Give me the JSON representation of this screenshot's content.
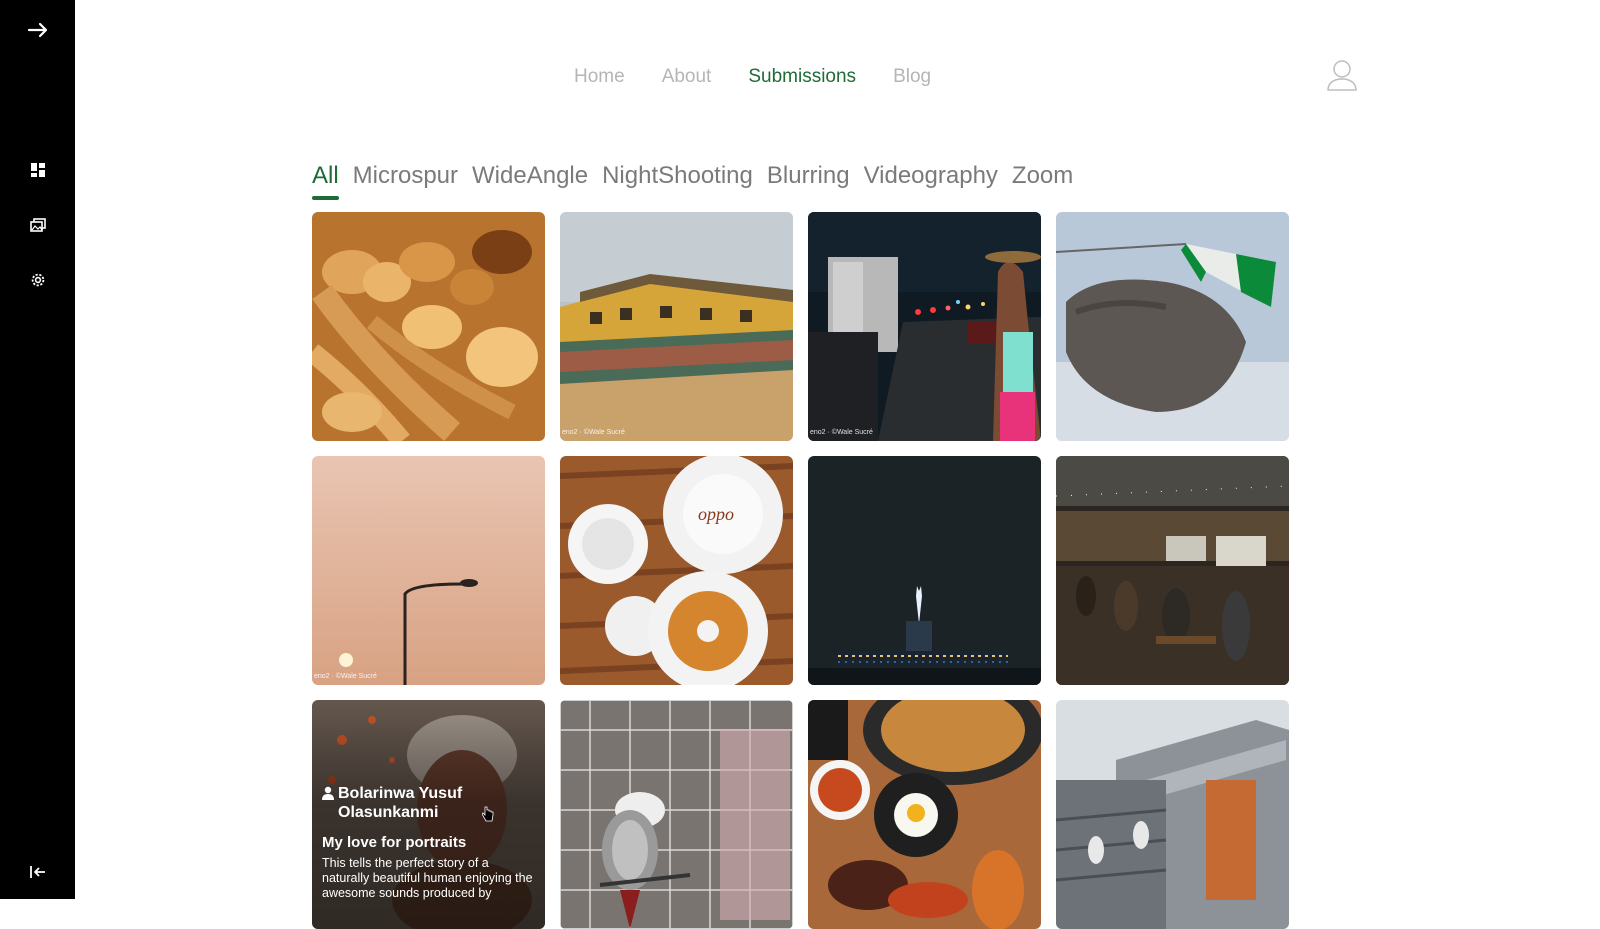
{
  "nav": {
    "items": [
      {
        "label": "Home",
        "active": false
      },
      {
        "label": "About",
        "active": false
      },
      {
        "label": "Submissions",
        "active": true
      },
      {
        "label": "Blog",
        "active": false
      }
    ],
    "user_icon": "user-outline-icon",
    "active_color": "#1f6b38",
    "inactive_color": "#b5b5b5"
  },
  "sidebar": {
    "icons": [
      "arrow-right-icon",
      "dashboard-icon",
      "gallery-icon",
      "settings-icon",
      "logout-icon"
    ],
    "background": "#000000"
  },
  "tabs": [
    {
      "label": "All",
      "active": true
    },
    {
      "label": "Microspur",
      "active": false
    },
    {
      "label": "WideAngle",
      "active": false
    },
    {
      "label": "NightShooting",
      "active": false
    },
    {
      "label": "Blurring",
      "active": false
    },
    {
      "label": "Videography",
      "active": false
    },
    {
      "label": "Zoom",
      "active": false
    }
  ],
  "photos": [
    {
      "subject": "bread",
      "watermark": ""
    },
    {
      "subject": "building-mural",
      "watermark": "eno2 · ©Wale Sucré"
    },
    {
      "subject": "night-traffic",
      "watermark": "eno2 · ©Wale Sucré"
    },
    {
      "subject": "hand-flag",
      "watermark": ""
    },
    {
      "subject": "sunset-streetlight",
      "watermark": "eno2 · ©Wale Sucré"
    },
    {
      "subject": "coffee-donut",
      "watermark": ""
    },
    {
      "subject": "night-tower",
      "watermark": ""
    },
    {
      "subject": "night-market",
      "watermark": ""
    },
    {
      "subject": "portrait",
      "watermark": ""
    },
    {
      "subject": "parrot",
      "watermark": ""
    },
    {
      "subject": "food-table",
      "watermark": ""
    },
    {
      "subject": "stadium",
      "watermark": ""
    }
  ],
  "hover_card": {
    "author": "Bolarinwa Yusuf Olasunkanmi",
    "title": "My love for portraits",
    "description": "This tells the perfect story of a naturally beautiful human enjoying the awesome sounds produced by"
  }
}
